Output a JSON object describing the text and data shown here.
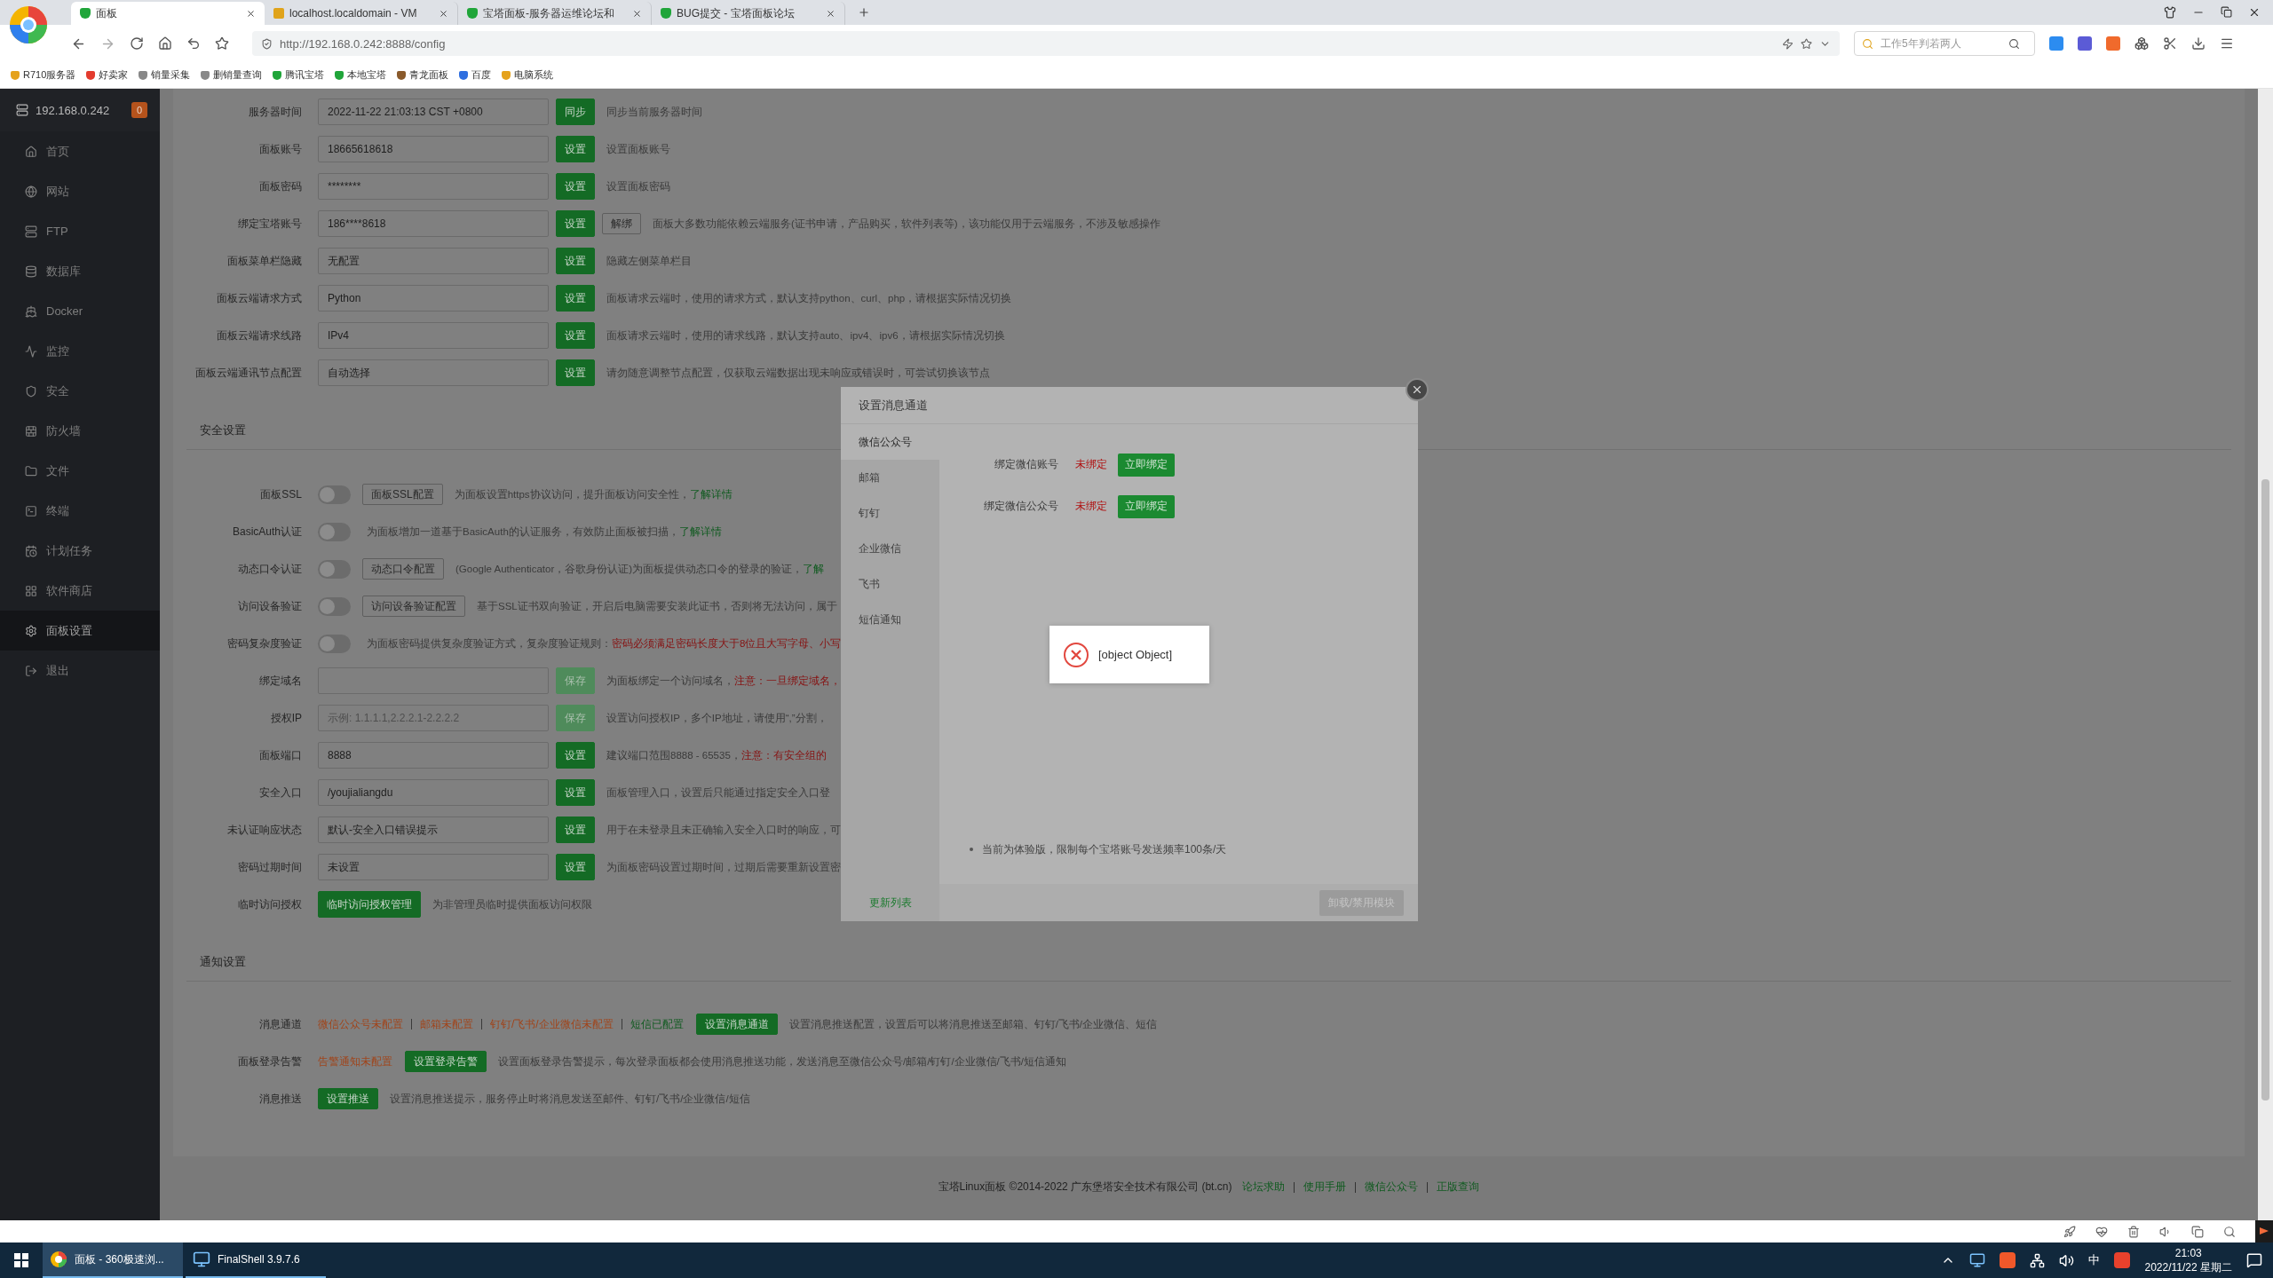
{
  "browser": {
    "tabs": [
      {
        "title": "面板",
        "selected": true,
        "kind": "panel"
      },
      {
        "title": "localhost.localdomain - VM",
        "selected": false,
        "kind": "edit"
      },
      {
        "title": "宝塔面板-服务器运维论坛和",
        "selected": false,
        "kind": "panel"
      },
      {
        "title": "BUG提交 - 宝塔面板论坛",
        "selected": false,
        "kind": "panel"
      }
    ],
    "address": "http://192.168.0.242:8888/config",
    "search_placeholder": "工作5年判若两人",
    "bookmarks": [
      "R710服务器",
      "好卖家",
      "销量采集",
      "删销量查询",
      "腾讯宝塔",
      "本地宝塔",
      "青龙面板",
      "百度",
      "电脑系统"
    ]
  },
  "sidebar": {
    "host": "192.168.0.242",
    "badge": "0",
    "items": [
      {
        "label": "首页",
        "selected": false
      },
      {
        "label": "网站",
        "selected": false
      },
      {
        "label": "FTP",
        "selected": false
      },
      {
        "label": "数据库",
        "selected": false
      },
      {
        "label": "Docker",
        "selected": false
      },
      {
        "label": "监控",
        "selected": false
      },
      {
        "label": "安全",
        "selected": false
      },
      {
        "label": "防火墙",
        "selected": false
      },
      {
        "label": "文件",
        "selected": false
      },
      {
        "label": "终端",
        "selected": false
      },
      {
        "label": "计划任务",
        "selected": false
      },
      {
        "label": "软件商店",
        "selected": false
      },
      {
        "label": "面板设置",
        "selected": true
      },
      {
        "label": "退出",
        "selected": false
      }
    ]
  },
  "panel_settings": {
    "rows": [
      {
        "kind": "input",
        "label": "服务器时间",
        "value": "2022-11-22 21:03:13 CST +0800",
        "buttons": [
          {
            "label": "同步",
            "kind": "primary",
            "disabled": false
          }
        ],
        "note": [
          {
            "text": "同步当前服务器时间",
            "kind": "plain"
          }
        ]
      },
      {
        "kind": "input",
        "label": "面板账号",
        "value": "18665618618",
        "buttons": [
          {
            "label": "设置",
            "kind": "primary",
            "disabled": false
          }
        ],
        "note": [
          {
            "text": "设置面板账号",
            "kind": "plain"
          }
        ]
      },
      {
        "kind": "input",
        "label": "面板密码",
        "value": "********",
        "buttons": [
          {
            "label": "设置",
            "kind": "primary",
            "disabled": false
          }
        ],
        "note": [
          {
            "text": "设置面板密码",
            "kind": "plain"
          }
        ]
      },
      {
        "kind": "input",
        "label": "绑定宝塔账号",
        "value": "186****8618",
        "buttons": [
          {
            "label": "设置",
            "kind": "primary",
            "disabled": false
          },
          {
            "label": "解绑",
            "kind": "plain",
            "disabled": false
          }
        ],
        "note": [
          {
            "text": "面板大多数功能依赖云端服务(证书申请，产品购买，软件列表等)，该功能仅用于云端服务，不涉及敏感操作",
            "kind": "plain"
          }
        ]
      },
      {
        "kind": "input",
        "label": "面板菜单栏隐藏",
        "value": "无配置",
        "buttons": [
          {
            "label": "设置",
            "kind": "primary",
            "disabled": false
          }
        ],
        "note": [
          {
            "text": "隐藏左侧菜单栏目",
            "kind": "plain"
          }
        ]
      },
      {
        "kind": "input",
        "label": "面板云端请求方式",
        "value": "Python",
        "buttons": [
          {
            "label": "设置",
            "kind": "primary",
            "disabled": false
          }
        ],
        "note": [
          {
            "text": "面板请求云端时，使用的请求方式，默认支持python、curl、php，请根据实际情况切换",
            "kind": "plain"
          }
        ]
      },
      {
        "kind": "input",
        "label": "面板云端请求线路",
        "value": "IPv4",
        "buttons": [
          {
            "label": "设置",
            "kind": "primary",
            "disabled": false
          }
        ],
        "note": [
          {
            "text": "面板请求云端时，使用的请求线路，默认支持auto、ipv4、ipv6，请根据实际情况切换",
            "kind": "plain"
          }
        ]
      },
      {
        "kind": "input",
        "label": "面板云端通讯节点配置",
        "value": "自动选择",
        "buttons": [
          {
            "label": "设置",
            "kind": "primary",
            "disabled": false
          }
        ],
        "note": [
          {
            "text": "请勿随意调整节点配置，仅获取云端数据出现未响应或错误时，可尝试切换该节点",
            "kind": "plain"
          }
        ]
      }
    ]
  },
  "security": {
    "title": "安全设置",
    "rows": [
      {
        "kind": "toggle",
        "label": "面板SSL",
        "on": false,
        "buttons": [
          {
            "label": "面板SSL配置",
            "kind": "plain",
            "disabled": false
          }
        ],
        "note": [
          {
            "text": "为面板设置https协议访问，提升面板访问安全性，",
            "kind": "plain"
          },
          {
            "text": "了解详情",
            "kind": "link"
          }
        ]
      },
      {
        "kind": "toggle",
        "label": "BasicAuth认证",
        "on": false,
        "note": [
          {
            "text": "为面板增加一道基于BasicAuth的认证服务，有效防止面板被扫描，",
            "kind": "plain"
          },
          {
            "text": "了解详情",
            "kind": "link"
          }
        ]
      },
      {
        "kind": "toggle",
        "label": "动态口令认证",
        "on": false,
        "buttons": [
          {
            "label": "动态口令配置",
            "kind": "plain",
            "disabled": false
          }
        ],
        "note": [
          {
            "text": "(Google Authenticator，谷歌身份认证)为面板提供动态口令的登录的验证，",
            "kind": "plain"
          },
          {
            "text": "了解",
            "kind": "link"
          }
        ]
      },
      {
        "kind": "toggle",
        "label": "访问设备验证",
        "on": false,
        "buttons": [
          {
            "label": "访问设备验证配置",
            "kind": "plain",
            "disabled": false
          }
        ],
        "note": [
          {
            "text": "基于SSL证书双向验证，开启后电脑需要安装此证书，否则将无法访问，属于",
            "kind": "plain"
          }
        ]
      },
      {
        "kind": "toggle",
        "label": "密码复杂度验证",
        "on": false,
        "note": [
          {
            "text": "为面板密码提供复杂度验证方式，复杂度验证规则：",
            "kind": "plain"
          },
          {
            "text": "密码必须满足密码长度大于8位且大写字母、小写",
            "kind": "red"
          }
        ]
      },
      {
        "kind": "input",
        "label": "绑定域名",
        "buttons": [
          {
            "label": "保存",
            "kind": "primary",
            "disabled": true
          }
        ],
        "note": [
          {
            "text": "为面板绑定一个访问域名，",
            "kind": "plain"
          },
          {
            "text": "注意：一旦绑定域名，",
            "kind": "red"
          }
        ]
      },
      {
        "kind": "input",
        "label": "授权IP",
        "placeholder": "示例: 1.1.1.1,2.2.2.1-2.2.2.2",
        "buttons": [
          {
            "label": "保存",
            "kind": "primary",
            "disabled": true
          }
        ],
        "note": [
          {
            "text": "设置访问授权IP，多个IP地址，请使用“,”分割，",
            "kind": "plain"
          }
        ]
      },
      {
        "kind": "input",
        "label": "面板端口",
        "value": "8888",
        "buttons": [
          {
            "label": "设置",
            "kind": "primary",
            "disabled": false
          }
        ],
        "note": [
          {
            "text": "建议端口范围8888 - 65535，",
            "kind": "plain"
          },
          {
            "text": "注意：有安全组的",
            "kind": "red"
          }
        ]
      },
      {
        "kind": "input",
        "label": "安全入口",
        "value": "/youjialiangdu",
        "buttons": [
          {
            "label": "设置",
            "kind": "primary",
            "disabled": false
          }
        ],
        "note": [
          {
            "text": "面板管理入口，设置后只能通过指定安全入口登",
            "kind": "plain"
          }
        ]
      },
      {
        "kind": "input",
        "label": "未认证响应状态",
        "value": "默认-安全入口错误提示",
        "buttons": [
          {
            "label": "设置",
            "kind": "primary",
            "disabled": false
          }
        ],
        "note": [
          {
            "text": "用于在未登录且未正确输入安全入口时的响应，可",
            "kind": "plain"
          }
        ]
      },
      {
        "kind": "input",
        "label": "密码过期时间",
        "value": "未设置",
        "buttons": [
          {
            "label": "设置",
            "kind": "primary",
            "disabled": false
          }
        ],
        "note": [
          {
            "text": "为面板密码设置过期时间，过期后需要重新设置密",
            "kind": "plain"
          }
        ]
      },
      {
        "kind": "action",
        "label": "临时访问授权",
        "buttons": [
          {
            "label": "临时访问授权管理",
            "kind": "primary",
            "disabled": false
          }
        ],
        "note": [
          {
            "text": "为非管理员临时提供面板访问权限",
            "kind": "plain"
          }
        ]
      }
    ]
  },
  "notifications": {
    "title": "通知设置",
    "rows": [
      {
        "label": "消息通道",
        "statuses": [
          {
            "text": "微信公众号未配置",
            "configured": false
          },
          {
            "text": "邮箱未配置",
            "configured": false
          },
          {
            "text": "钉钉/飞书/企业微信未配置",
            "configured": false
          },
          {
            "text": "短信已配置",
            "configured": true
          }
        ],
        "button": "设置消息通道",
        "note": "设置消息推送配置，设置后可以将消息推送至邮箱、钉钉/飞书/企业微信、短信"
      },
      {
        "label": "面板登录告警",
        "statuses": [
          {
            "text": "告警通知未配置",
            "configured": false
          }
        ],
        "button": "设置登录告警",
        "note": "设置面板登录告警提示，每次登录面板都会使用消息推送功能，发送消息至微信公众号/邮箱/钉钉/企业微信/飞书/短信通知"
      },
      {
        "label": "消息推送",
        "button": "设置推送",
        "note": "设置消息推送提示，服务停止时将消息发送至邮件、钉钉/飞书/企业微信/短信"
      }
    ]
  },
  "footer": {
    "copyright": "宝塔Linux面板 ©2014-2022 广东堡塔安全技术有限公司 (bt.cn)",
    "links": [
      "论坛求助",
      "使用手册",
      "微信公众号",
      "正版查询"
    ]
  },
  "dialog": {
    "title": "设置消息通道",
    "tabs": [
      {
        "label": "微信公众号",
        "selected": true
      },
      {
        "label": "邮箱",
        "selected": false
      },
      {
        "label": "钉钉",
        "selected": false
      },
      {
        "label": "企业微信",
        "selected": false
      },
      {
        "label": "飞书",
        "selected": false
      },
      {
        "label": "短信通知",
        "selected": false
      }
    ],
    "refresh_link": "更新列表",
    "bindings": [
      {
        "label": "绑定微信账号",
        "status": "未绑定",
        "bound": false,
        "button": "立即绑定"
      },
      {
        "label": "绑定微信公众号",
        "status": "未绑定",
        "bound": false,
        "button": "立即绑定"
      }
    ],
    "tip": "当前为体验版，限制每个宝塔账号发送频率100条/天",
    "footer_button": {
      "label": "卸载/禁用模块",
      "disabled": true
    }
  },
  "toast": {
    "kind": "error",
    "message": "[object Object]"
  },
  "taskbar": {
    "items": [
      {
        "title": "面板 - 360极速浏...",
        "selected": true,
        "kind": "browser"
      },
      {
        "title": "FinalShell 3.9.7.6",
        "selected": false,
        "kind": "terminal"
      }
    ],
    "ime": "中",
    "time": "21:03",
    "date": "2022/11/22 星期二"
  }
}
